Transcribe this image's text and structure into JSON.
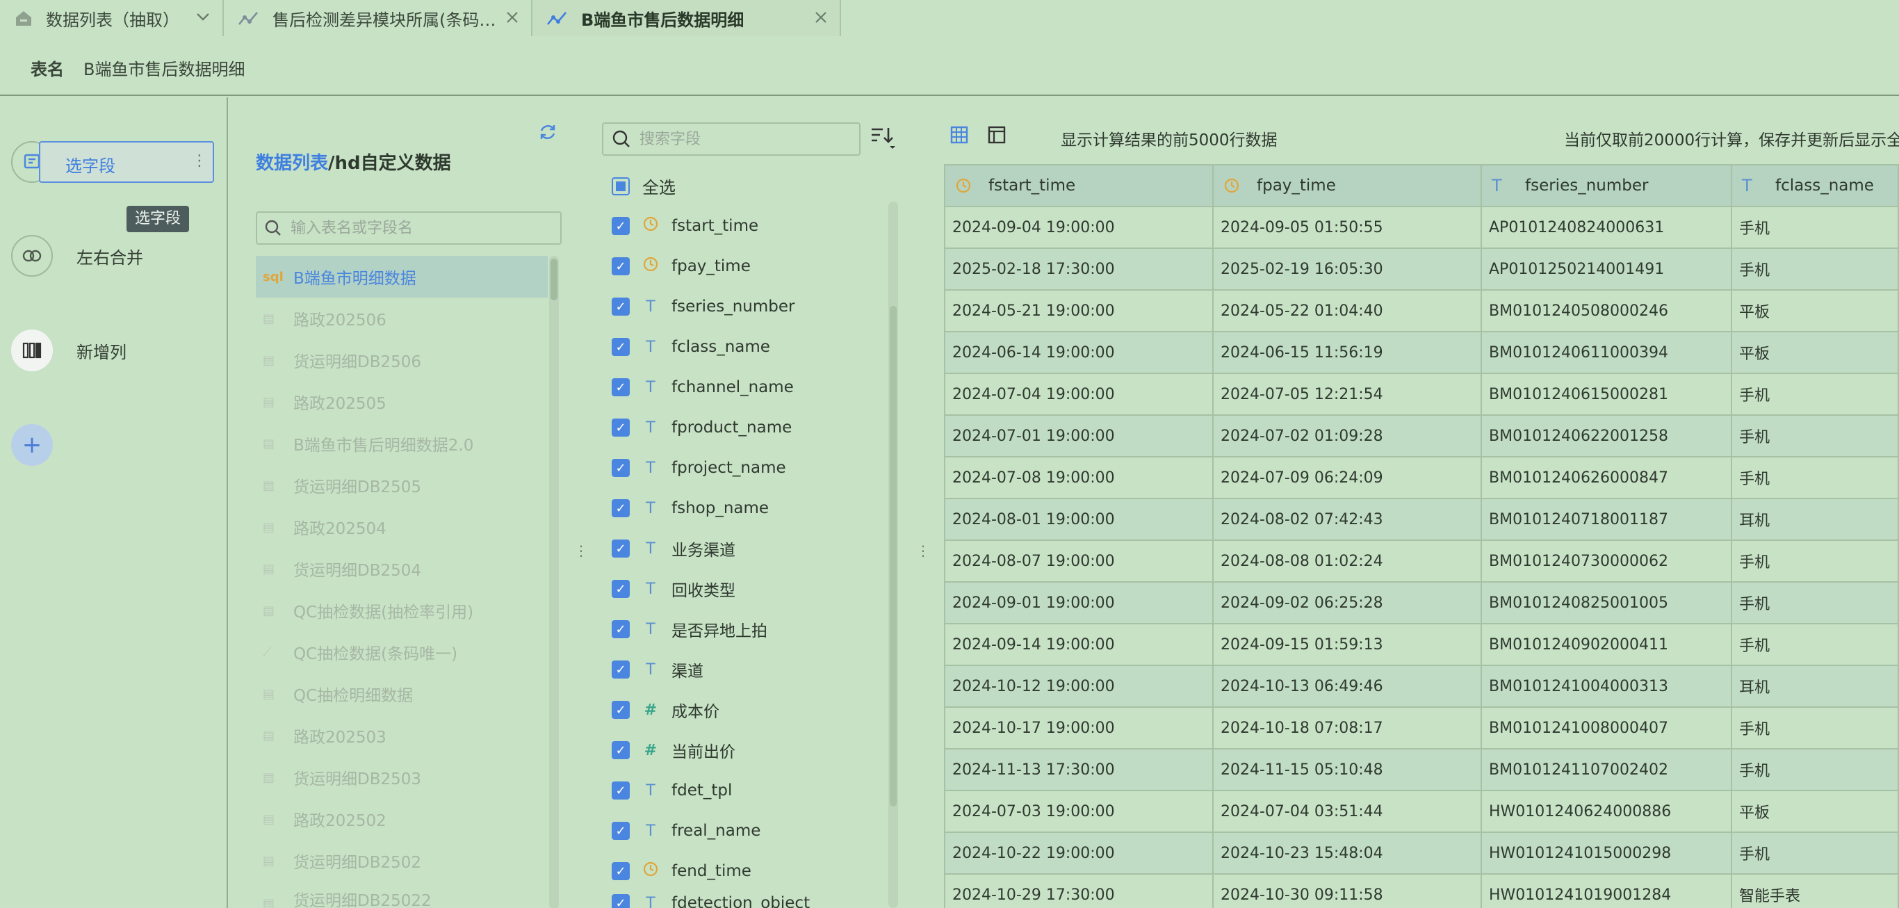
{
  "tabs": [
    {
      "label": "数据列表（抽取）",
      "icon": "home-icon",
      "active": false
    },
    {
      "label": "售后检测差异模块所属(条码…",
      "icon": "line-chart-icon",
      "active": false
    },
    {
      "label": "B端鱼市售后数据明细",
      "icon": "line-chart-icon",
      "active": true
    }
  ],
  "table_name": {
    "key": "表名",
    "value": "B端鱼市售后数据明细"
  },
  "steps": [
    {
      "label": "选字段",
      "icon": "select-field-icon",
      "active": true,
      "tooltip": "选字段"
    },
    {
      "label": "左右合并",
      "icon": "merge-icon",
      "active": false
    },
    {
      "label": "新增列",
      "icon": "add-column-icon",
      "active": false
    }
  ],
  "source_panel": {
    "title_prefix": "数据列表",
    "title_suffix": "/hd自定义数据",
    "search_placeholder": "输入表名或字段名",
    "items": [
      {
        "label": "B端鱼市明细数据",
        "icon": "sql",
        "selected": true
      },
      {
        "label": "路政202506",
        "icon": "db"
      },
      {
        "label": "货运明细DB2506",
        "icon": "db"
      },
      {
        "label": "路政202505",
        "icon": "db"
      },
      {
        "label": "B端鱼市售后明细数据2.0",
        "icon": "db"
      },
      {
        "label": "货运明细DB2505",
        "icon": "db"
      },
      {
        "label": "路政202504",
        "icon": "db"
      },
      {
        "label": "货运明细DB2504",
        "icon": "db"
      },
      {
        "label": "QC抽检数据(抽检率引用)",
        "icon": "db"
      },
      {
        "label": "QC抽检数据(条码唯一)",
        "icon": "chart"
      },
      {
        "label": "QC抽检明细数据",
        "icon": "db"
      },
      {
        "label": "路政202503",
        "icon": "db"
      },
      {
        "label": "货运明细DB2503",
        "icon": "db"
      },
      {
        "label": "路政202502",
        "icon": "db"
      },
      {
        "label": "货运明细DB2502",
        "icon": "db"
      },
      {
        "label": "货运明细DB25022",
        "icon": "db"
      }
    ]
  },
  "field_panel": {
    "search_placeholder": "搜索字段",
    "select_all": "全选",
    "fields": [
      {
        "name": "fstart_time",
        "type": "time"
      },
      {
        "name": "fpay_time",
        "type": "time"
      },
      {
        "name": "fseries_number",
        "type": "text"
      },
      {
        "name": "fclass_name",
        "type": "text"
      },
      {
        "name": "fchannel_name",
        "type": "text"
      },
      {
        "name": "fproduct_name",
        "type": "text"
      },
      {
        "name": "fproject_name",
        "type": "text"
      },
      {
        "name": "fshop_name",
        "type": "text"
      },
      {
        "name": "业务渠道",
        "type": "text"
      },
      {
        "name": "回收类型",
        "type": "text"
      },
      {
        "name": "是否异地上拍",
        "type": "text"
      },
      {
        "name": "渠道",
        "type": "text"
      },
      {
        "name": "成本价",
        "type": "number"
      },
      {
        "name": "当前出价",
        "type": "number"
      },
      {
        "name": "fdet_tpl",
        "type": "text"
      },
      {
        "name": "freal_name",
        "type": "text"
      },
      {
        "name": "fend_time",
        "type": "time"
      },
      {
        "name": "fdetection_object",
        "type": "text"
      }
    ]
  },
  "preview": {
    "info_left": "显示计算结果的前5000行数据",
    "info_right": "当前仅取前20000行计算，保存并更新后显示全",
    "columns": [
      {
        "name": "fstart_time",
        "type": "time"
      },
      {
        "name": "fpay_time",
        "type": "time"
      },
      {
        "name": "fseries_number",
        "type": "text"
      },
      {
        "name": "fclass_name",
        "type": "text"
      }
    ],
    "rows": [
      [
        "2024-09-04 19:00:00",
        "2024-09-05 01:50:55",
        "AP0101240824000631",
        "手机"
      ],
      [
        "2025-02-18 17:30:00",
        "2025-02-19 16:05:30",
        "AP0101250214001491",
        "手机"
      ],
      [
        "2024-05-21 19:00:00",
        "2024-05-22 01:04:40",
        "BM0101240508000246",
        "平板"
      ],
      [
        "2024-06-14 19:00:00",
        "2024-06-15 11:56:19",
        "BM0101240611000394",
        "平板"
      ],
      [
        "2024-07-04 19:00:00",
        "2024-07-05 12:21:54",
        "BM0101240615000281",
        "手机"
      ],
      [
        "2024-07-01 19:00:00",
        "2024-07-02 01:09:28",
        "BM0101240622001258",
        "手机"
      ],
      [
        "2024-07-08 19:00:00",
        "2024-07-09 06:24:09",
        "BM0101240626000847",
        "手机"
      ],
      [
        "2024-08-01 19:00:00",
        "2024-08-02 07:42:43",
        "BM0101240718001187",
        "耳机"
      ],
      [
        "2024-08-07 19:00:00",
        "2024-08-08 01:02:24",
        "BM0101240730000062",
        "手机"
      ],
      [
        "2024-09-01 19:00:00",
        "2024-09-02 06:25:28",
        "BM0101240825001005",
        "手机"
      ],
      [
        "2024-09-14 19:00:00",
        "2024-09-15 01:59:13",
        "BM0101240902000411",
        "手机"
      ],
      [
        "2024-10-12 19:00:00",
        "2024-10-13 06:49:46",
        "BM0101241004000313",
        "耳机"
      ],
      [
        "2024-10-17 19:00:00",
        "2024-10-18 07:08:17",
        "BM0101241008000407",
        "手机"
      ],
      [
        "2024-11-13 17:30:00",
        "2024-11-15 05:10:48",
        "BM0101241107002402",
        "手机"
      ],
      [
        "2024-07-03 19:00:00",
        "2024-07-04 03:51:44",
        "HW0101240624000886",
        "平板"
      ],
      [
        "2024-10-22 19:00:00",
        "2024-10-23 15:48:04",
        "HW0101241015000298",
        "手机"
      ],
      [
        "2024-10-29 17:30:00",
        "2024-10-30 09:11:58",
        "HW0101241019001284",
        "智能手表"
      ]
    ]
  },
  "colors": {
    "accent": "#3f7fe0",
    "background": "#c8e2c6",
    "time_icon": "#e0a63a",
    "number_icon": "#3aa58a"
  }
}
